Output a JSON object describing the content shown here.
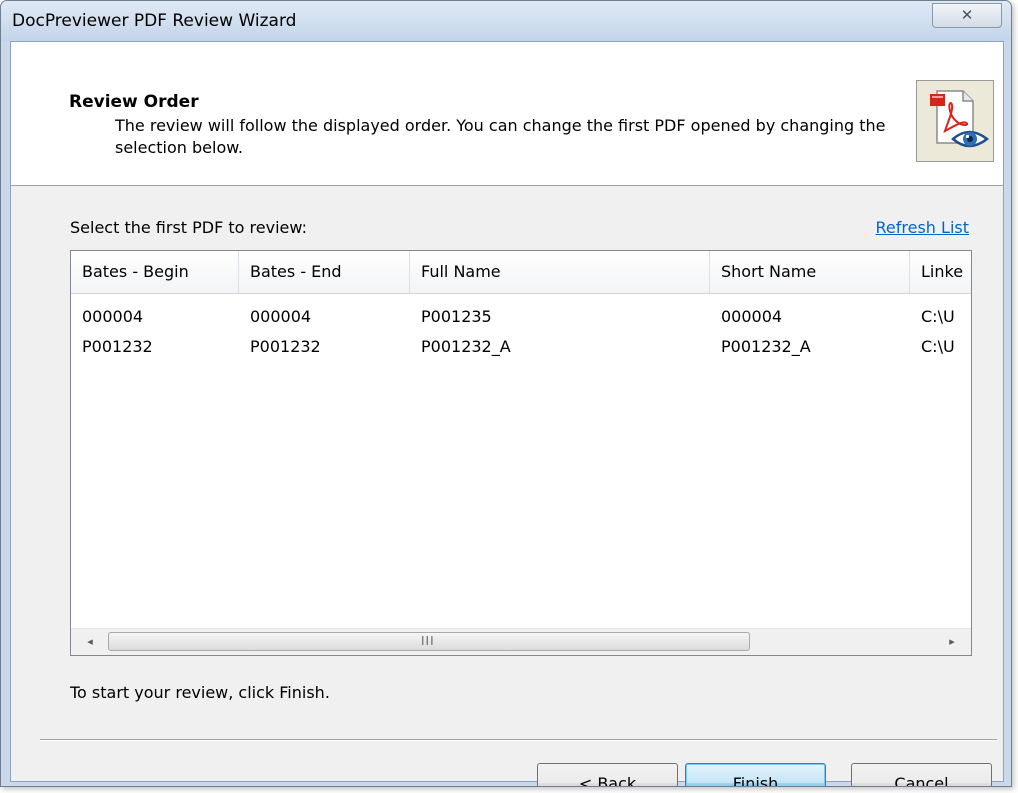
{
  "window": {
    "title": "DocPreviewer PDF Review Wizard",
    "close_glyph": "✕"
  },
  "header": {
    "title": "Review Order",
    "description": "The review will follow the displayed order.  You can change the first PDF opened by changing the selection below.",
    "icon": "pdf-review-eye-icon"
  },
  "list": {
    "label": "Select the first PDF to review:",
    "refresh_label": "Refresh List",
    "columns": [
      "Bates - Begin",
      "Bates - End",
      "Full Name",
      "Short Name",
      "Linke"
    ],
    "rows": [
      [
        "000004",
        "000004",
        "P001235",
        "000004",
        "C:\\U"
      ],
      [
        "P001232",
        "P001232",
        "P001232_A",
        "P001232_A",
        "C:\\U"
      ]
    ],
    "scroll_left": "◂",
    "scroll_right": "▸",
    "scroll_grip": "III"
  },
  "footer": {
    "hint": "To start your review, click Finish.",
    "back_label": "< Back",
    "finish_label": "Finish",
    "cancel_label": "Cancel"
  },
  "colors": {
    "link": "#0066cc",
    "primary_button": "#98d1ef",
    "pdf_red": "#d9241c"
  }
}
